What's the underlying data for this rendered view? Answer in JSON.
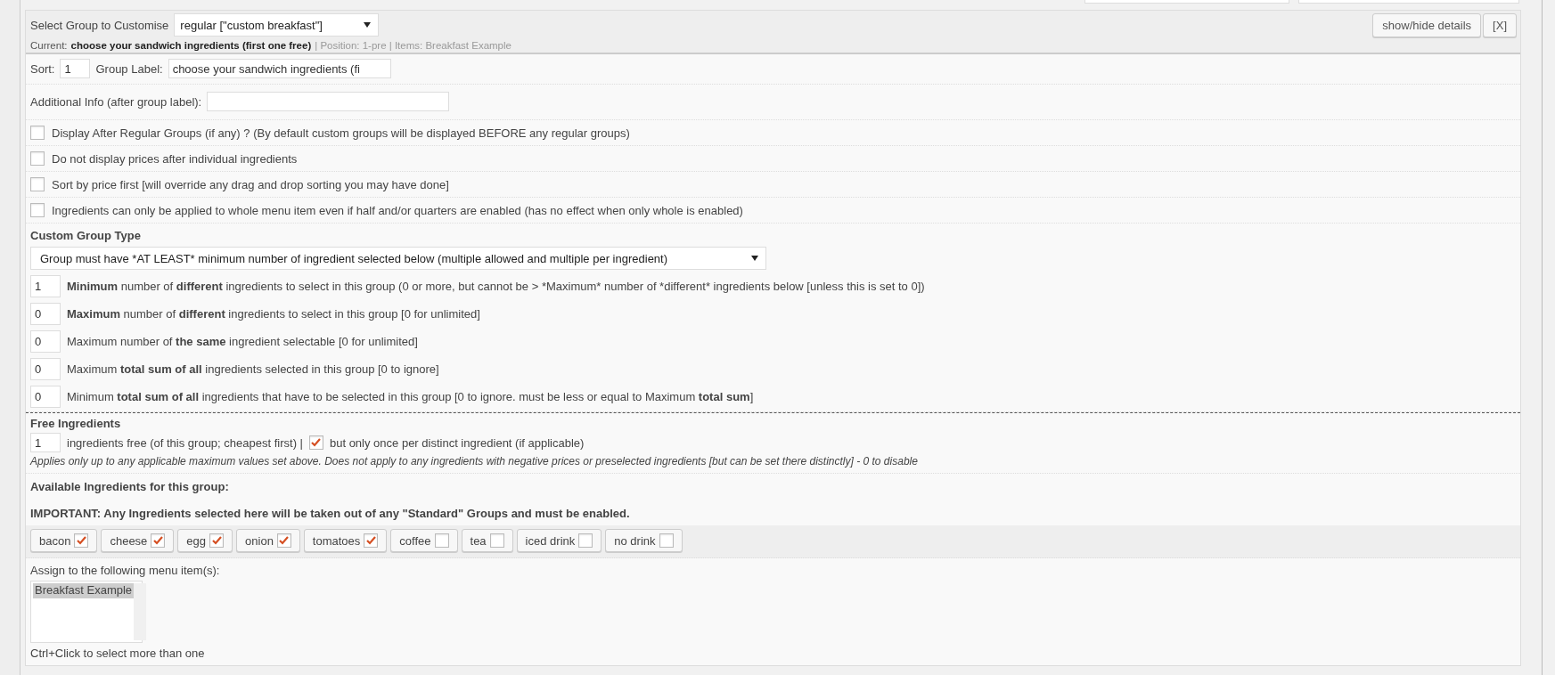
{
  "header": {
    "label": "Select Group to Customise",
    "group_select": "regular [\"custom breakfast\"]",
    "current_label": "Current:",
    "current_value": "choose your sandwich ingredients (first one free)",
    "details": "| Position: 1-pre | Items: Breakfast Example",
    "buttons": [
      "show/hide details",
      "[X]"
    ]
  },
  "sort": {
    "label": "Sort:",
    "value": "1"
  },
  "group_label": {
    "label": "Group Label:",
    "value": "choose your sandwich ingredients (fi"
  },
  "additional_info": {
    "label": "Additional Info (after group label):"
  },
  "options": [
    {
      "label": "Display After Regular Groups (if any) ? (By default custom groups will be displayed BEFORE any regular groups)",
      "checked": false
    },
    {
      "label": "Do not display prices after individual ingredients",
      "checked": false
    },
    {
      "label": "Sort by price first [will override any drag and drop sorting you may have done]",
      "checked": false
    },
    {
      "label": "Ingredients can only be applied to whole menu item even if half and/or quarters are enabled (has no effect when only whole is enabled)",
      "checked": false
    }
  ],
  "custom_group_type": {
    "title": "Custom Group Type",
    "select": "Group must have *AT LEAST* minimum number of ingredient selected below (multiple allowed and multiple per ingredient)"
  },
  "limits": [
    {
      "value": "1",
      "parts": [
        {
          "text": "Minimum",
          "bold": true
        },
        {
          "text": " number of ",
          "bold": false
        },
        {
          "text": "different",
          "bold": true
        },
        {
          "text": " ingredients to select in this group (0 or more, but cannot be > *Maximum* number of *different* ingredients below [unless this is set to 0])",
          "bold": false
        }
      ]
    },
    {
      "value": "0",
      "parts": [
        {
          "text": "Maximum",
          "bold": true
        },
        {
          "text": " number of ",
          "bold": false
        },
        {
          "text": "different",
          "bold": true
        },
        {
          "text": " ingredients to select in this group [0 for unlimited]",
          "bold": false
        }
      ]
    },
    {
      "value": "0",
      "parts": [
        {
          "text": "Maximum number of ",
          "bold": false
        },
        {
          "text": "the same",
          "bold": true
        },
        {
          "text": " ingredient selectable [0 for unlimited]",
          "bold": false
        }
      ]
    },
    {
      "value": "0",
      "parts": [
        {
          "text": "Maximum ",
          "bold": false
        },
        {
          "text": "total sum of all",
          "bold": true
        },
        {
          "text": " ingredients selected in this group [0 to ignore]",
          "bold": false
        }
      ]
    },
    {
      "value": "0",
      "parts": [
        {
          "text": "Minimum ",
          "bold": false
        },
        {
          "text": "total sum of all",
          "bold": true
        },
        {
          "text": " ingredients that have to be selected in this group [0 to ignore. must be less or equal to Maximum ",
          "bold": false
        },
        {
          "text": "total sum",
          "bold": true
        },
        {
          "text": "]",
          "bold": false
        }
      ]
    }
  ],
  "free_ingredients": {
    "title": "Free Ingredients",
    "value": "1",
    "label": "ingredients free (of this group; cheapest first) |",
    "once_checked": true,
    "once_label": "but only once per distinct ingredient (if applicable)",
    "note": "Applies only up to any applicable maximum values set above. Does not apply to any ingredients with negative prices or preselected ingredients [but can be set there distinctly] - 0 to disable"
  },
  "available": {
    "title": "Available Ingredients for this group:",
    "important": "IMPORTANT: Any Ingredients selected here will be taken out of any \"Standard\" Groups and must be enabled."
  },
  "ingredients": [
    {
      "label": "bacon",
      "checked": true
    },
    {
      "label": "cheese",
      "checked": true
    },
    {
      "label": "egg",
      "checked": true
    },
    {
      "label": "onion",
      "checked": true
    },
    {
      "label": "tomatoes",
      "checked": true
    },
    {
      "label": "coffee",
      "checked": false
    },
    {
      "label": "tea",
      "checked": false
    },
    {
      "label": "iced drink",
      "checked": false
    },
    {
      "label": "no drink",
      "checked": false
    }
  ],
  "assign": {
    "label": "Assign to the following menu item(s):",
    "items": [
      {
        "label": "Breakfast Example",
        "selected": true
      }
    ],
    "hint": "Ctrl+Click to select more than one"
  }
}
